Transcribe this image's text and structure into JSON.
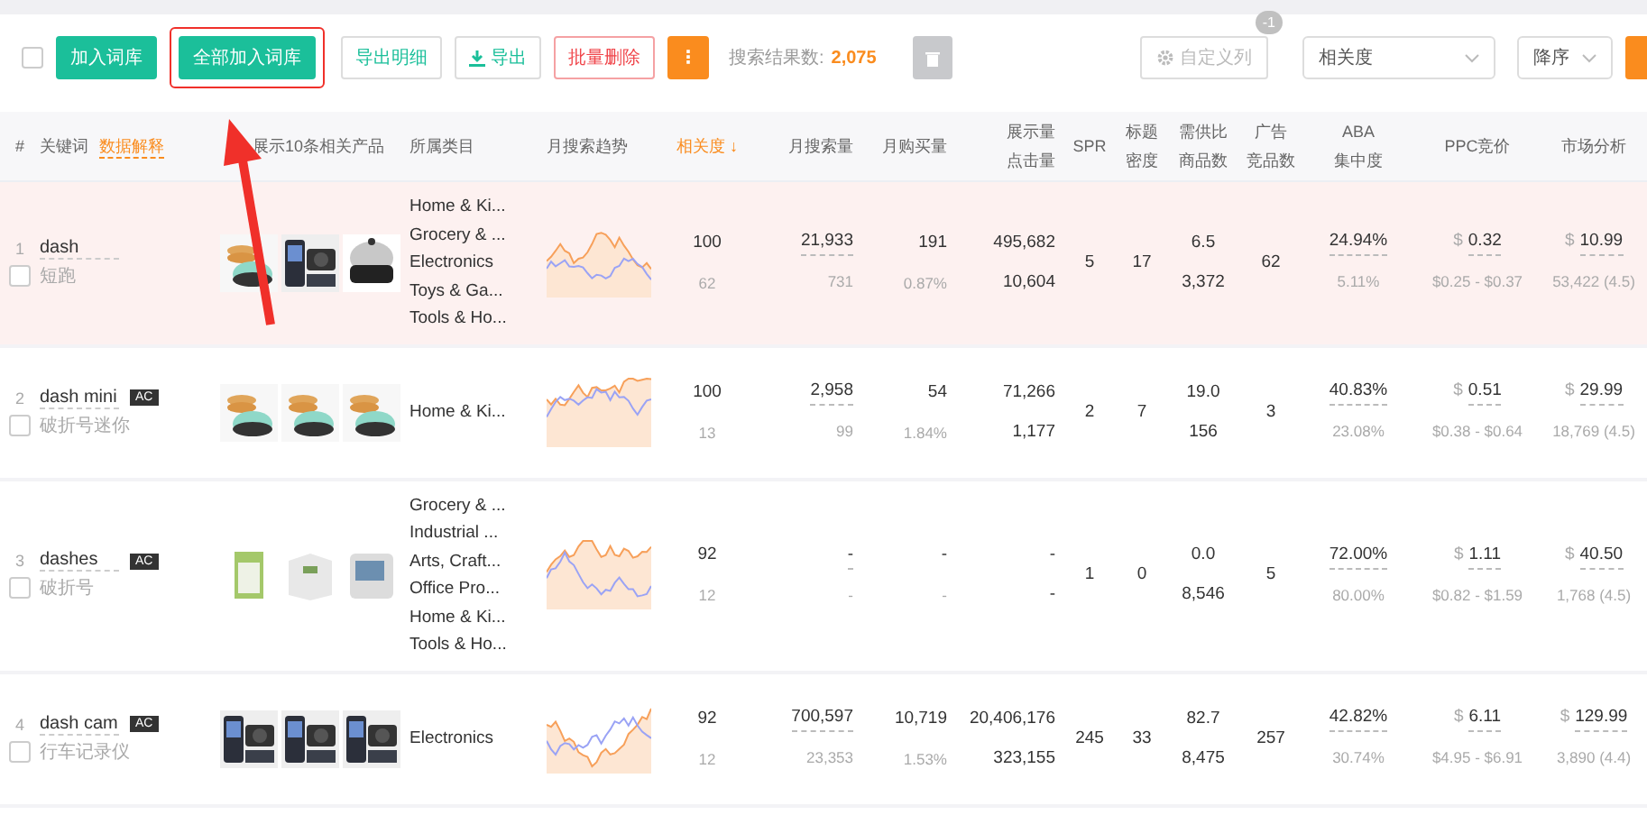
{
  "toolbar": {
    "select_all_checked": false,
    "buttons": [
      {
        "label": "加入词库",
        "kind": "primary",
        "annotated": false
      },
      {
        "label": "全部加入词库",
        "kind": "primary",
        "annotated": true
      },
      {
        "label": "导出明细",
        "kind": "outline",
        "annotated": false
      },
      {
        "label": "导出",
        "kind": "download",
        "annotated": false
      },
      {
        "label": "批量删除",
        "kind": "danger",
        "annotated": false
      },
      {
        "label": "⋮",
        "kind": "more",
        "annotated": false
      }
    ],
    "result_label": "搜索结果数:",
    "result_count": "2,075",
    "trash_disabled": true,
    "custom_columns": {
      "label": "自定义列",
      "badge": "-1"
    },
    "sort_field": "相关度",
    "sort_order": "降序",
    "edge_buttons": [
      {
        "kind": "accent"
      }
    ]
  },
  "table": {
    "columns": [
      {
        "lines": [
          "#"
        ]
      },
      {
        "lines": [
          "关键词"
        ],
        "link": "数据解释"
      },
      {
        "lines": [
          "展示10条相关产品"
        ]
      },
      {
        "lines": [
          "所属类目"
        ]
      },
      {
        "lines": [
          "月搜索趋势"
        ]
      },
      {
        "lines": [
          "相关度 ↓"
        ],
        "sorted": true
      },
      {
        "lines": [
          "月搜索量"
        ]
      },
      {
        "lines": [
          "月购买量"
        ]
      },
      {
        "lines": [
          "展示量",
          "点击量"
        ]
      },
      {
        "lines": [
          "SPR"
        ]
      },
      {
        "lines": [
          "标题",
          "密度"
        ]
      },
      {
        "lines": [
          "需供比",
          "商品数"
        ]
      },
      {
        "lines": [
          "广告",
          "竞品数"
        ]
      },
      {
        "lines": [
          "ABA",
          "集中度"
        ]
      },
      {
        "lines": [
          "PPC竞价"
        ]
      },
      {
        "lines": [
          "市场分析"
        ]
      }
    ],
    "rows": [
      {
        "index": "1",
        "keyword": "dash",
        "translation": "短跑",
        "highlighted": true,
        "checked": false,
        "products": [
          {
            "kind": "picture"
          },
          {
            "kind": "picture"
          },
          {
            "kind": "picture"
          }
        ],
        "categories": [
          "Home & Ki...",
          "Grocery & ...",
          "Electronics",
          "Toys & Ga...",
          "Tools & Ho..."
        ],
        "relevance": [
          "100",
          "62"
        ],
        "search": [
          "21,933",
          "731"
        ],
        "purchase": [
          "191",
          "0.87%"
        ],
        "impressions": [
          "495,682",
          "10,604"
        ],
        "spr": "5",
        "title_density": "17",
        "supply": [
          "6.5",
          "3,372"
        ],
        "ads": "62",
        "aba": [
          "24.94%",
          "5.11%"
        ],
        "ppc": {
          "currency": "$",
          "bid": "0.32",
          "range": "$0.25 - $0.37"
        },
        "market": {
          "currency": "$",
          "price": "10.99",
          "sales": "53,422 (4.5)"
        }
      },
      {
        "index": "2",
        "keyword": "dash mini",
        "badge": "AC",
        "translation": "破折号迷你",
        "highlighted": false,
        "checked": false,
        "products": [
          {
            "kind": "picture"
          },
          {
            "kind": "picture"
          },
          {
            "kind": "picture"
          }
        ],
        "categories": [
          "Home & Ki..."
        ],
        "relevance": [
          "100",
          "13"
        ],
        "search": [
          "2,958",
          "99"
        ],
        "purchase": [
          "54",
          "1.84%"
        ],
        "impressions": [
          "71,266",
          "1,177"
        ],
        "spr": "2",
        "title_density": "7",
        "supply": [
          "19.0",
          "156"
        ],
        "ads": "3",
        "aba": [
          "40.83%",
          "23.08%"
        ],
        "ppc": {
          "currency": "$",
          "bid": "0.51",
          "range": "$0.38 - $0.64"
        },
        "market": {
          "currency": "$",
          "price": "29.99",
          "sales": "18,769 (4.5)"
        }
      },
      {
        "index": "3",
        "keyword": "dashes",
        "badge": "AC",
        "translation": "破折号",
        "highlighted": false,
        "checked": false,
        "products": [
          {
            "kind": "picture"
          },
          {
            "kind": "picture"
          },
          {
            "kind": "picture"
          }
        ],
        "categories": [
          "Grocery & ...",
          "Industrial ...",
          "Arts, Craft...",
          "Office Pro...",
          "Home & Ki...",
          "Tools & Ho..."
        ],
        "relevance": [
          "92",
          "12"
        ],
        "search": [
          "-",
          "-"
        ],
        "purchase": [
          "-",
          "-"
        ],
        "impressions": [
          "-",
          "-"
        ],
        "spr": "1",
        "title_density": "0",
        "supply": [
          "0.0",
          "8,546"
        ],
        "ads": "5",
        "aba": [
          "72.00%",
          "80.00%"
        ],
        "ppc": {
          "currency": "$",
          "bid": "1.11",
          "range": "$0.82 - $1.59"
        },
        "market": {
          "currency": "$",
          "price": "40.50",
          "sales": "1,768 (4.5)"
        }
      },
      {
        "index": "4",
        "keyword": "dash cam",
        "badge": "AC",
        "translation": "行车记录仪",
        "highlighted": false,
        "checked": false,
        "products": [
          {
            "kind": "picture"
          },
          {
            "kind": "picture"
          },
          {
            "kind": "picture"
          }
        ],
        "categories": [
          "Electronics"
        ],
        "relevance": [
          "92",
          "12"
        ],
        "search": [
          "700,597",
          "23,353"
        ],
        "purchase": [
          "10,719",
          "1.53%"
        ],
        "impressions": [
          "20,406,176",
          "323,155"
        ],
        "spr": "245",
        "title_density": "33",
        "supply": [
          "82.7",
          "8,475"
        ],
        "ads": "257",
        "aba": [
          "42.82%",
          "30.74%"
        ],
        "ppc": {
          "currency": "$",
          "bid": "6.11",
          "range": "$4.95 - $6.91"
        },
        "market": {
          "currency": "$",
          "price": "129.99",
          "sales": "3,890 (4.4)"
        }
      }
    ]
  }
}
